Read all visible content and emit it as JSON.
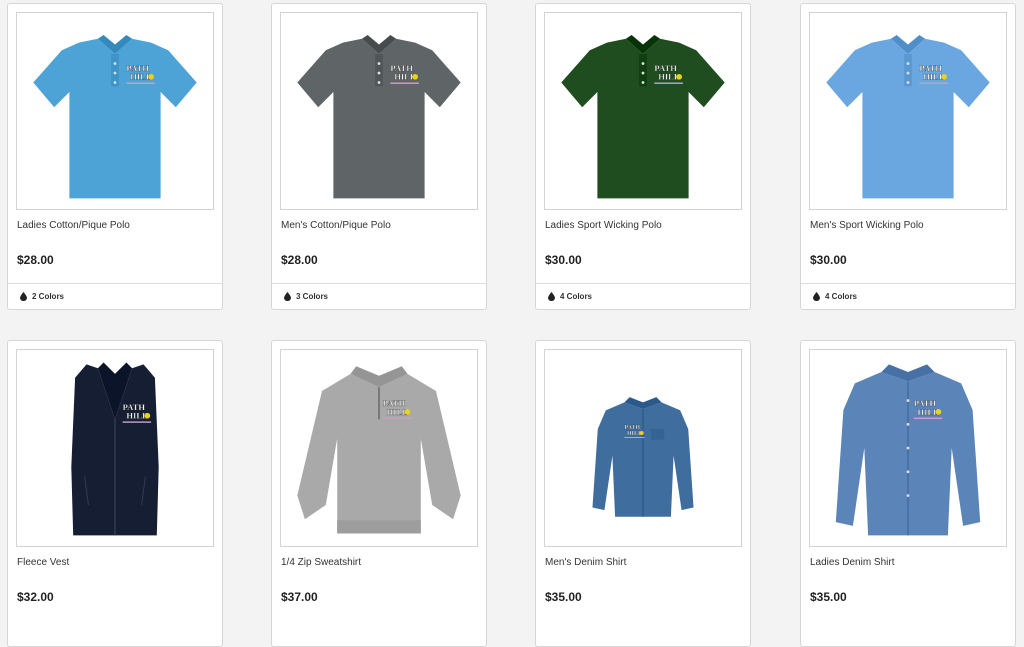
{
  "products": [
    {
      "title": "Ladies Cotton/Pique Polo",
      "price": "$28.00",
      "colors_label": "2 Colors",
      "image_icon": "ladies-polo-light-blue",
      "garment_color": "#4da3d6"
    },
    {
      "title": "Men's Cotton/Pique Polo",
      "price": "$28.00",
      "colors_label": "3 Colors",
      "image_icon": "mens-polo-grey",
      "garment_color": "#5f6466"
    },
    {
      "title": "Ladies Sport Wicking Polo",
      "price": "$30.00",
      "colors_label": "4 Colors",
      "image_icon": "ladies-polo-dark-green",
      "garment_color": "#1f4d1f"
    },
    {
      "title": "Men's Sport Wicking Polo",
      "price": "$30.00",
      "colors_label": "4 Colors",
      "image_icon": "mens-polo-carolina-blue",
      "garment_color": "#6aa7e0"
    },
    {
      "title": "Fleece Vest",
      "price": "$32.00",
      "colors_label": "",
      "image_icon": "fleece-vest-navy",
      "garment_color": "#151e33"
    },
    {
      "title": "1/4 Zip Sweatshirt",
      "price": "$37.00",
      "colors_label": "",
      "image_icon": "quarter-zip-sweatshirt-grey",
      "garment_color": "#a9a9a9"
    },
    {
      "title": "Men's Denim Shirt",
      "price": "$35.00",
      "colors_label": "",
      "image_icon": "mens-denim-shirt",
      "garment_color": "#3f6d9e"
    },
    {
      "title": "Ladies Denim Shirt",
      "price": "$35.00",
      "colors_label": "",
      "image_icon": "ladies-denim-shirt",
      "garment_color": "#5b85b9"
    }
  ],
  "logo_text": [
    "PATH",
    "HILL"
  ]
}
